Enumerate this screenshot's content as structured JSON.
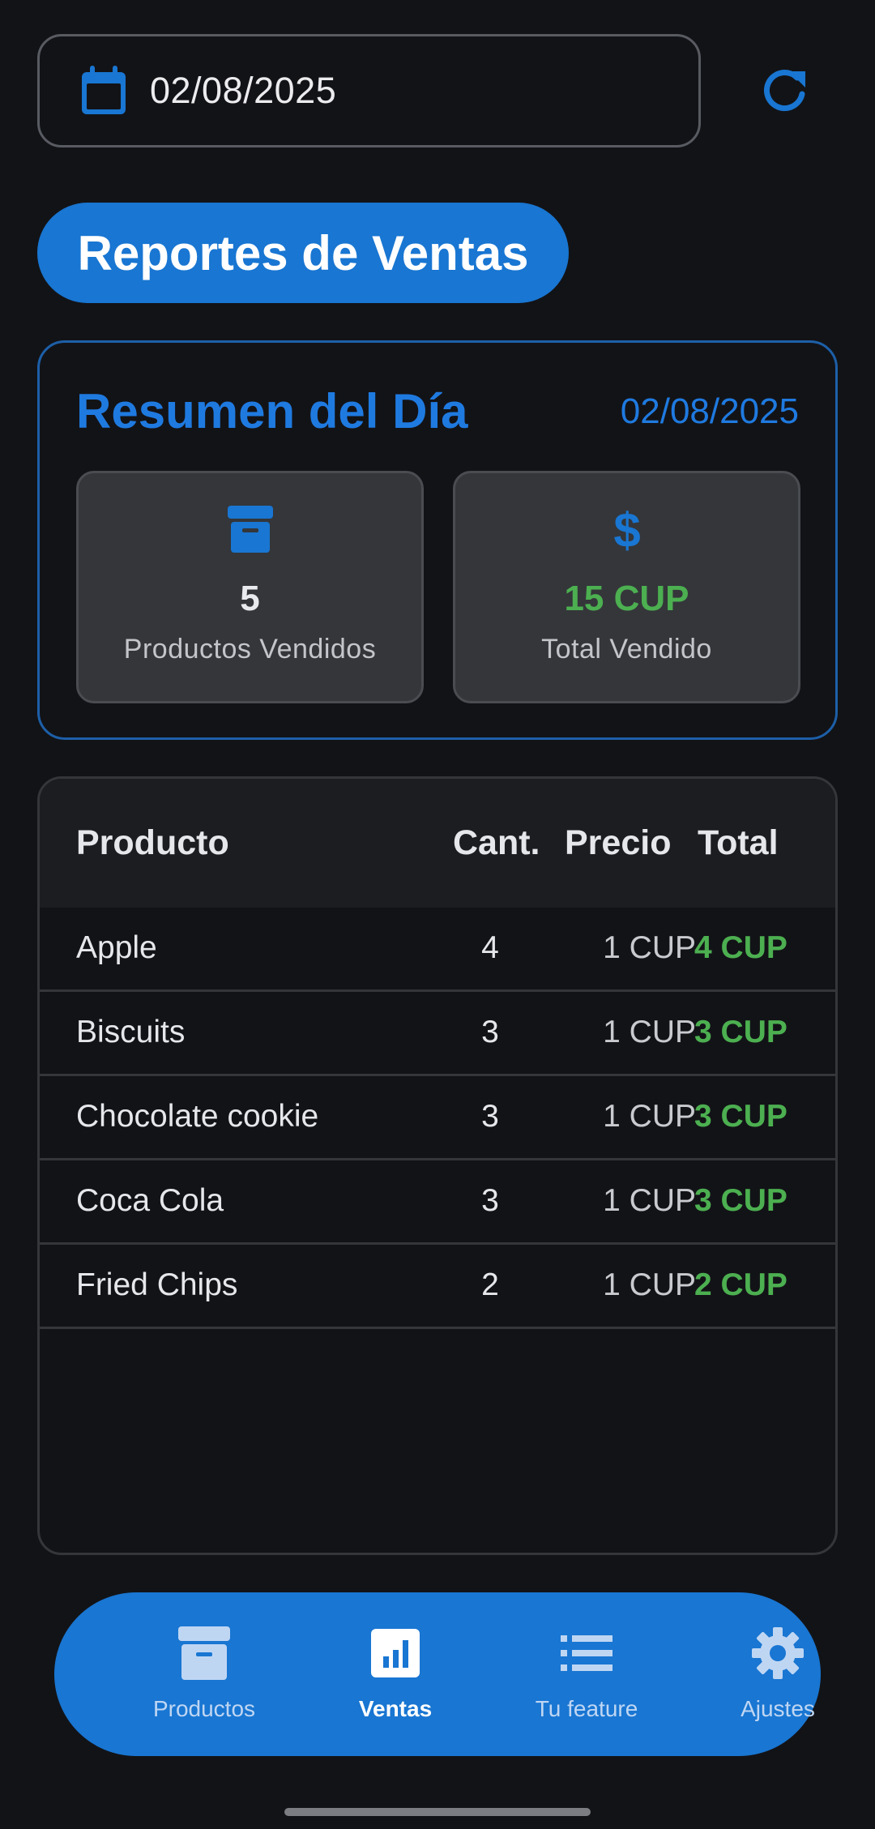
{
  "date_picker": {
    "value": "02/08/2025",
    "icon": "calendar-icon"
  },
  "refresh": {
    "icon": "refresh-icon"
  },
  "title": "Reportes de Ventas",
  "summary": {
    "title": "Resumen del Día",
    "date": "02/08/2025",
    "stats": [
      {
        "icon": "archive-box-icon",
        "value": "5",
        "label": "Productos Vendidos"
      },
      {
        "icon": "dollar-icon",
        "value": "15 CUP",
        "label": "Total Vendido"
      }
    ]
  },
  "table": {
    "headers": {
      "product": "Producto",
      "qty": "Cant.",
      "price": "Precio",
      "total": "Total"
    },
    "rows": [
      {
        "product": "Apple",
        "qty": "4",
        "price": "1 CUP",
        "total": "4 CUP"
      },
      {
        "product": "Biscuits",
        "qty": "3",
        "price": "1 CUP",
        "total": "3 CUP"
      },
      {
        "product": "Chocolate cookie",
        "qty": "3",
        "price": "1 CUP",
        "total": "3 CUP"
      },
      {
        "product": "Coca Cola",
        "qty": "3",
        "price": "1 CUP",
        "total": "3 CUP"
      },
      {
        "product": "Fried Chips",
        "qty": "2",
        "price": "1 CUP",
        "total": "2 CUP"
      }
    ]
  },
  "nav": {
    "items": [
      {
        "label": "Productos",
        "icon": "archive-box-icon",
        "active": false
      },
      {
        "label": "Ventas",
        "icon": "bar-chart-icon",
        "active": true
      },
      {
        "label": "Tu feature",
        "icon": "list-icon",
        "active": false
      },
      {
        "label": "Ajustes",
        "icon": "gear-icon",
        "active": false
      }
    ]
  },
  "colors": {
    "accent": "#1976d2",
    "accent_text": "#1f7ae0",
    "positive": "#4caf50",
    "background": "#121317"
  }
}
